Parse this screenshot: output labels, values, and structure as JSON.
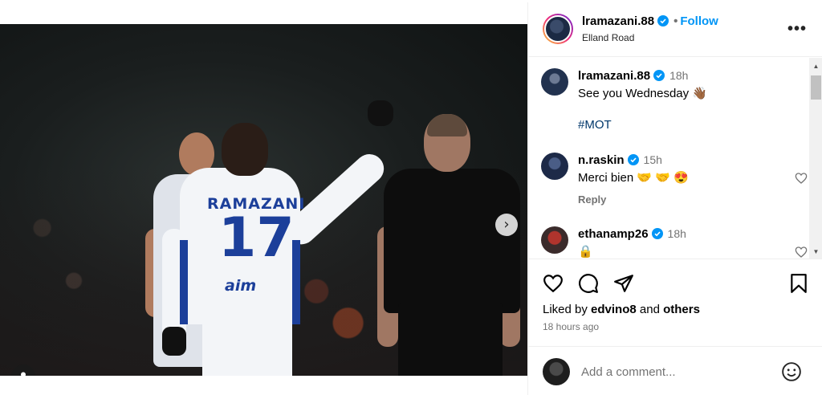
{
  "post": {
    "author": "lramazani.88",
    "location": "Elland Road",
    "follow_label": "Follow",
    "separator": "•",
    "more_label": "•••",
    "media": {
      "shirt_name": "RAMAZANI",
      "shirt_number": "17",
      "shirt_sponsor": "aim",
      "next_arrow": "›",
      "carousel_dots": 5,
      "active_dot": 0
    }
  },
  "caption": {
    "username": "lramazani.88",
    "time": "18h",
    "text": "See you Wednesday 👋🏾",
    "hashtag": "#MOT"
  },
  "comments": [
    {
      "username": "n.raskin",
      "verified": true,
      "time": "15h",
      "text": "Merci bien 🤝 🤝 😍",
      "reply_label": "Reply"
    },
    {
      "username": "ethanamp26",
      "verified": true,
      "time": "18h",
      "text": "🔒"
    }
  ],
  "likes": {
    "prefix": "Liked by",
    "user": "edvino8",
    "conjunction": "and",
    "others": "others"
  },
  "timestamp": "18 hours ago",
  "add_comment": {
    "placeholder": "Add a comment..."
  },
  "scrollbar": {
    "up": "▲",
    "down": "▼"
  },
  "colors": {
    "accent": "#0095f6",
    "verified": "#0095f6",
    "hashtag": "#00376b",
    "secondary_text": "#737373",
    "leeds_blue": "#1c3f9a"
  },
  "icons": {
    "header": [
      "verified-badge-icon",
      "more-options-icon"
    ],
    "actions": [
      "heart-icon",
      "comment-icon",
      "share-icon",
      "bookmark-icon"
    ],
    "media": [
      "chevron-right-icon",
      "user-tag-icon"
    ],
    "composer": [
      "emoji-icon"
    ]
  }
}
